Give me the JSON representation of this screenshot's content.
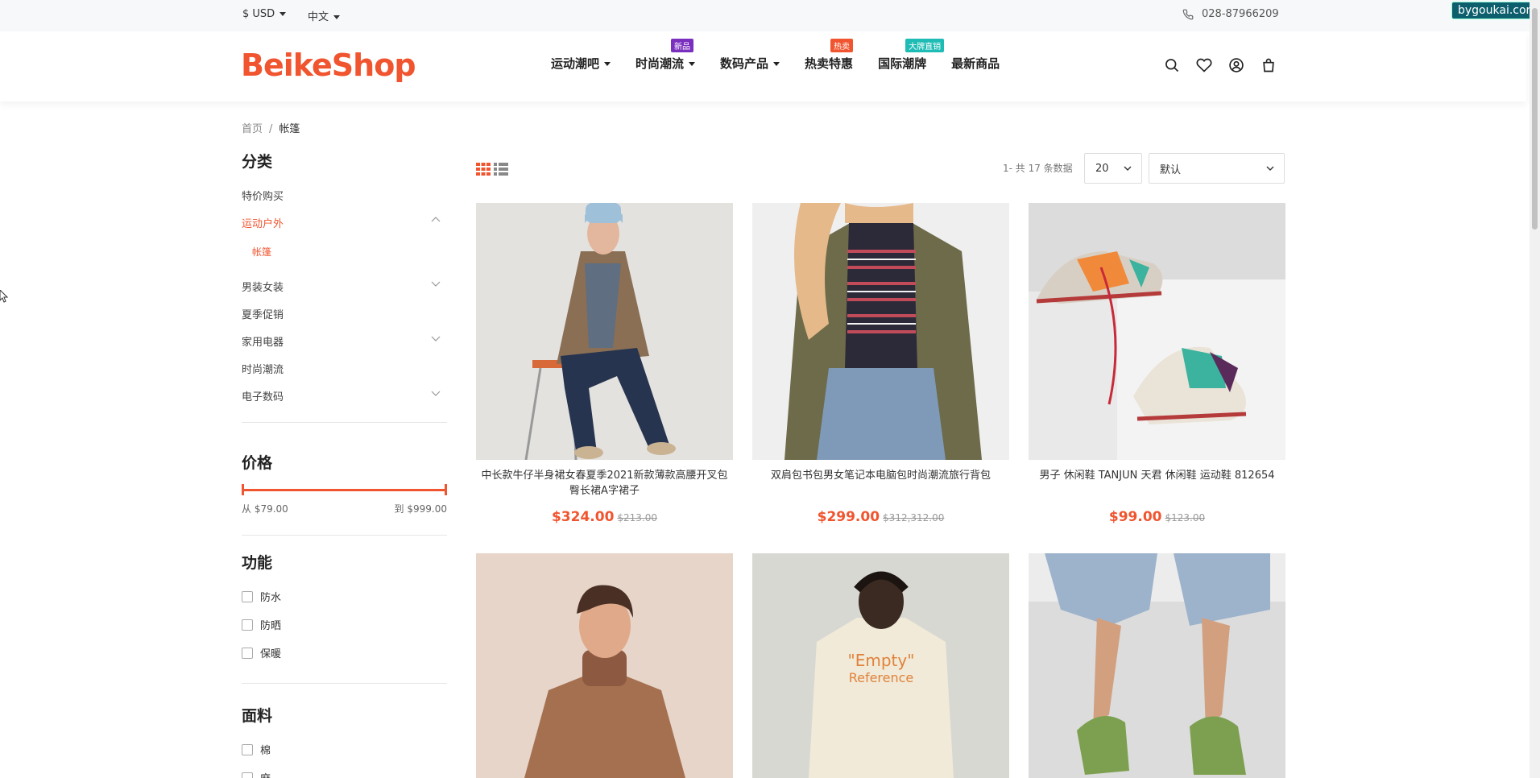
{
  "topbar": {
    "currency": "$ USD",
    "language": "中文",
    "phone": "028-87966209",
    "watermark": "bygoukai.com"
  },
  "header": {
    "logo": "BeikeShop",
    "nav": [
      {
        "label": "运动潮吧",
        "dropdown": true,
        "badge": ""
      },
      {
        "label": "时尚潮流",
        "dropdown": true,
        "badge": "新品",
        "badge_color": "#7b2fbf"
      },
      {
        "label": "数码产品",
        "dropdown": true,
        "badge": ""
      },
      {
        "label": "热卖特惠",
        "dropdown": false,
        "badge": "热卖",
        "badge_color": "#f0552f"
      },
      {
        "label": "国际潮牌",
        "dropdown": false,
        "badge": "大牌直销",
        "badge_color": "#1fbcb5"
      },
      {
        "label": "最新商品",
        "dropdown": false,
        "badge": ""
      }
    ]
  },
  "breadcrumb": {
    "home": "首页",
    "sep": "/",
    "current": "帐篷"
  },
  "sidebar": {
    "category_title": "分类",
    "categories": [
      {
        "label": "特价购买"
      },
      {
        "label": "运动户外"
      },
      {
        "label": "帐篷"
      },
      {
        "label": "男装女装"
      },
      {
        "label": "夏季促销"
      },
      {
        "label": "家用电器"
      },
      {
        "label": "时尚潮流"
      },
      {
        "label": "电子数码"
      }
    ],
    "price_title": "价格",
    "price_from": "从 $79.00",
    "price_to": "到 $999.00",
    "feature_title": "功能",
    "features": [
      "防水",
      "防晒",
      "保暖"
    ],
    "fabric_title": "面料",
    "fabrics": [
      "棉",
      "麻"
    ]
  },
  "toolbar": {
    "count": "1- 共 17 条数据",
    "per_page": "20",
    "sort": "默认"
  },
  "products": [
    {
      "name": "中长款牛仔半身裙女春夏季2021新款薄款高腰开叉包臀长裙A字裙子",
      "price": "$324.00",
      "old_price": "$213.00"
    },
    {
      "name": "双肩包书包男女笔记本电脑包时尚潮流旅行背包",
      "price": "$299.00",
      "old_price": "$312,312.00"
    },
    {
      "name": "男子 休闲鞋 TANJUN 天君 休闲鞋 运动鞋 812654",
      "price": "$99.00",
      "old_price": "$123.00"
    },
    {
      "name": "",
      "price": "",
      "old_price": ""
    },
    {
      "name": "",
      "price": "",
      "old_price": ""
    },
    {
      "name": "",
      "price": "",
      "old_price": ""
    }
  ],
  "colors": {
    "accent": "#f0552f"
  }
}
